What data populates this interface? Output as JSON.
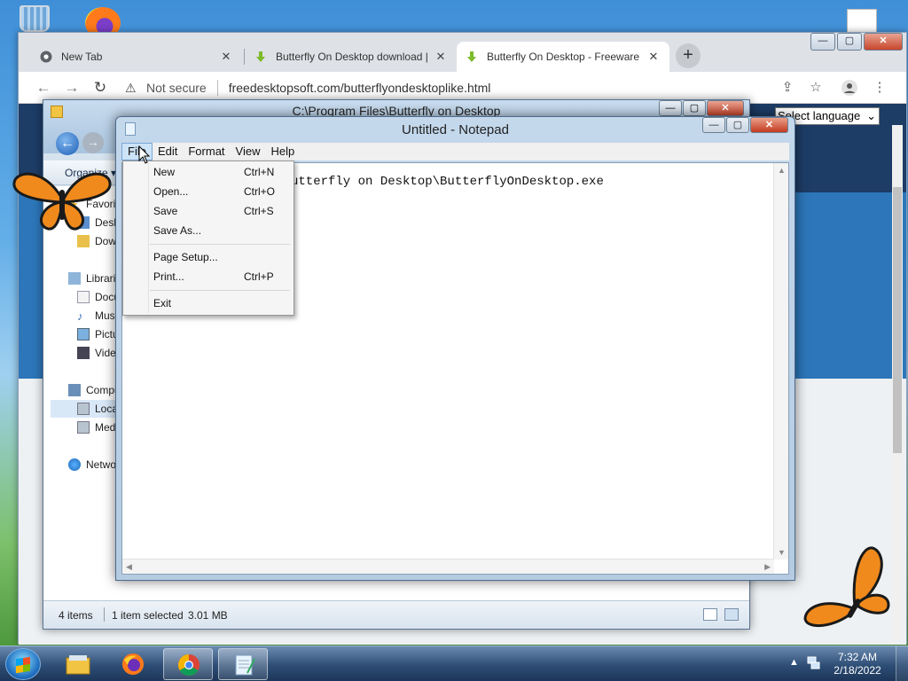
{
  "desktop": {
    "icons": [
      "recycle-bin-icon",
      "firefox-icon",
      "document-icon"
    ],
    "butterfly_color": "#f08a1c"
  },
  "chrome": {
    "tabs": [
      {
        "title": "New Tab",
        "favicon": "chrome-icon",
        "active": false
      },
      {
        "title": "Butterfly On Desktop download |",
        "favicon": "download-arrow-icon",
        "active": false
      },
      {
        "title": "Butterfly On Desktop - Freeware",
        "favicon": "download-arrow-icon",
        "active": true
      }
    ],
    "close_glyph": "✕",
    "new_tab_glyph": "+",
    "security_label": "Not secure",
    "url": "freedesktopsoft.com/butterflyondesktoplike.html",
    "language_select": "Select language",
    "window_buttons": {
      "minimize": "—",
      "maximize": "▢",
      "close": "✕"
    }
  },
  "explorer": {
    "title": "C:\\Program Files\\Butterfly on Desktop",
    "organize": "Organize ▾",
    "nav_items": [
      {
        "label": "Favorites",
        "icon": "star-icon"
      },
      {
        "label": "Desktop",
        "icon": "desktop-icon"
      },
      {
        "label": "Downloads",
        "icon": "downloads-icon"
      },
      {
        "label": "Libraries",
        "icon": "library-icon"
      },
      {
        "label": "Documents",
        "icon": "documents-icon"
      },
      {
        "label": "Music",
        "icon": "music-icon"
      },
      {
        "label": "Pictures",
        "icon": "pictures-icon"
      },
      {
        "label": "Videos",
        "icon": "videos-icon"
      },
      {
        "label": "Computer",
        "icon": "computer-icon"
      },
      {
        "label": "Local Disk (C:)",
        "icon": "drive-icon"
      },
      {
        "label": "Media (D:)",
        "icon": "drive-icon"
      },
      {
        "label": "Network",
        "icon": "network-icon"
      }
    ],
    "status": {
      "count": "4 items",
      "selected": "1 item selected",
      "size": "3.01 MB"
    }
  },
  "notepad": {
    "title": "Untitled - Notepad",
    "menus": [
      "File",
      "Edit",
      "Format",
      "View",
      "Help"
    ],
    "text": "C:\\Program Files\\Butterfly on Desktop\\ButterflyOnDesktop.exe",
    "visible_text": "utterfly on Desktop\\ButterflyOnDesktop.exe",
    "file_menu": [
      {
        "label": "New",
        "shortcut": "Ctrl+N"
      },
      {
        "label": "Open...",
        "shortcut": "Ctrl+O"
      },
      {
        "label": "Save",
        "shortcut": "Ctrl+S"
      },
      {
        "label": "Save As...",
        "shortcut": ""
      },
      {
        "label": "Page Setup...",
        "shortcut": ""
      },
      {
        "label": "Print...",
        "shortcut": "Ctrl+P"
      },
      {
        "label": "Exit",
        "shortcut": ""
      }
    ]
  },
  "taskbar": {
    "time": "7:32 AM",
    "date": "2/18/2022",
    "pinned": [
      "explorer-icon",
      "firefox-icon",
      "chrome-icon",
      "notepad-icon"
    ]
  }
}
